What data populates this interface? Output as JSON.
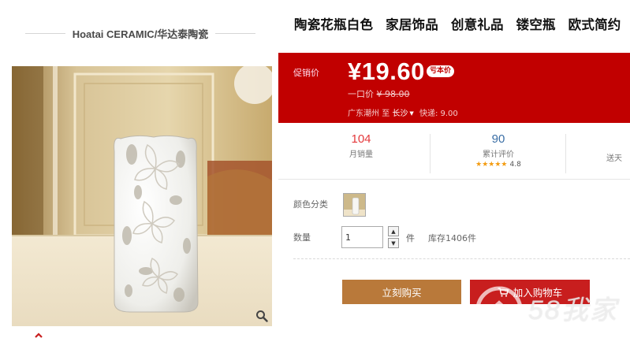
{
  "store": {
    "name": "Hoatai CERAMIC/华达泰陶瓷"
  },
  "product": {
    "title": "陶瓷花瓶白色 家居饰品 创意礼品 镂空瓶 欧式简约",
    "image_icon": "white-ceramic-vase-photo",
    "zoom_icon": "search-icon",
    "scroll_up_icon": "chevron-up-icon"
  },
  "price": {
    "label": "促销价",
    "value": "¥19.60",
    "badge": "亏本价",
    "original_label": "一口价",
    "original_value": "¥ 98.00",
    "ship_from": "广东潮州",
    "to_word": "至",
    "ship_to": "长沙",
    "shipping": "快递: 9.00"
  },
  "stats": {
    "monthly_sales": "104",
    "monthly_sales_label": "月销量",
    "reviews": "90",
    "reviews_label": "累计评价",
    "stars": "★★★★★",
    "rating": "4.8",
    "gift_label": "送天"
  },
  "options": {
    "color_label": "颜色分类",
    "quantity_label": "数量",
    "quantity_value": "1",
    "unit": "件",
    "stock": "库存1406件"
  },
  "buttons": {
    "buy_now": "立刻购买",
    "add_to_cart": "加入购物车"
  },
  "watermark": {
    "text": "58我家"
  },
  "colors": {
    "price_bg": "#c10000",
    "buy_button": "#b9793a",
    "cart_button": "#c81e1e",
    "accent_red": "#e4393c"
  }
}
